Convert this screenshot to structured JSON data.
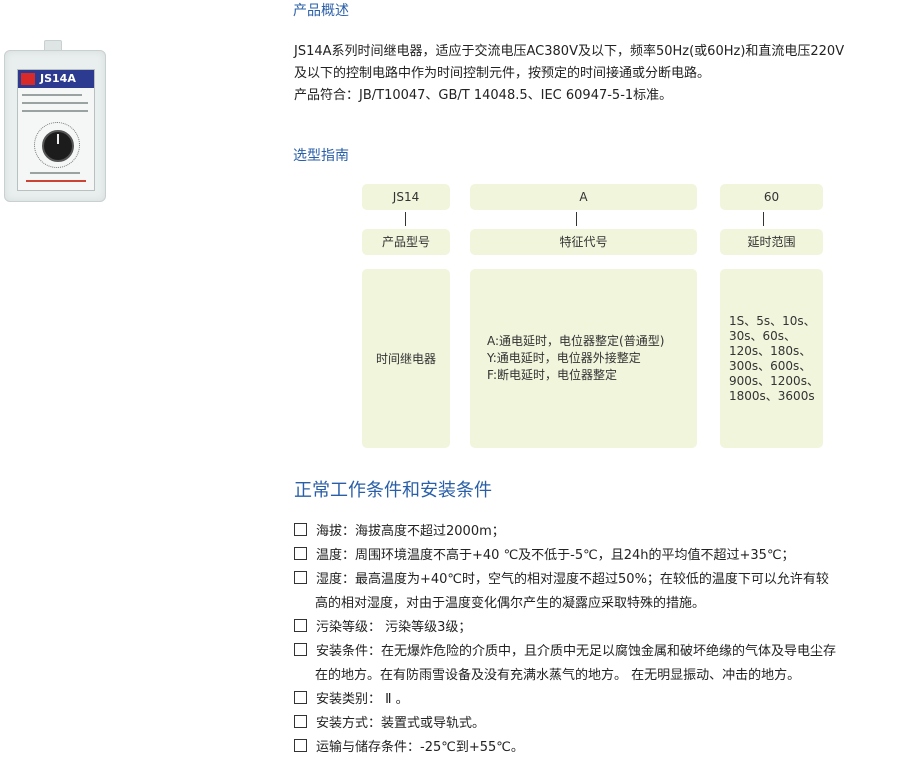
{
  "overview": {
    "heading": "产品概述",
    "lines": [
      "JS14A系列时间继电器，适应于交流电压AC380V及以下，频率50Hz(或60Hz)和直流电压220V",
      "及以下的控制电路中作为时间控制元件，按预定的时间接通或分断电路。",
      "产品符合：JB/T10047、GB/T 14048.5、IEC 60947-5-1标准。"
    ]
  },
  "photo": {
    "model_label": "JS14A"
  },
  "selection": {
    "heading": "选型指南",
    "codes": [
      "JS14",
      "A",
      "60"
    ],
    "captions": [
      "产品型号",
      "特征代号",
      "延时范围"
    ],
    "col1_desc": "时间继电器",
    "col2_lines": [
      "A:通电延时，电位器整定(普通型)",
      "Y:通电延时，电位器外接整定",
      "F:断电延时，电位器整定"
    ],
    "col3_lines": [
      "1S、5s、10s、",
      "30s、60s、",
      "120s、180s、",
      "300s、600s、",
      "900s、1200s、",
      "1800s、3600s"
    ]
  },
  "conditions": {
    "heading": "正常工作条件和安装条件",
    "items": [
      {
        "lines": [
          "海拔：海拔高度不超过2000m；"
        ]
      },
      {
        "lines": [
          "温度：周围环境温度不高于+40 ℃及不低于-5℃，且24h的平均值不超过+35℃；"
        ]
      },
      {
        "lines": [
          "湿度：最高温度为+40℃时，空气的相对湿度不超过50%；在较低的温度下可以允许有较",
          "高的相对湿度，对由于温度变化偶尔产生的凝露应采取特殊的措施。"
        ]
      },
      {
        "lines": [
          "污染等级： 污染等级3级；"
        ]
      },
      {
        "lines": [
          "安装条件：在无爆炸危险的介质中，且介质中无足以腐蚀金属和破坏绝缘的气体及导电尘存",
          "在的地方。在有防雨雪设备及没有充满水蒸气的地方。 在无明显振动、冲击的地方。"
        ]
      },
      {
        "lines": [
          "安装类别： Ⅱ 。"
        ]
      },
      {
        "lines": [
          "安装方式：装置式或导轨式。"
        ]
      },
      {
        "lines": [
          "运输与储存条件：-25℃到+55℃。"
        ]
      }
    ]
  },
  "colors": {
    "heading_blue": "#2a5fa8",
    "guide_box_bg": "#f0f5dc"
  }
}
